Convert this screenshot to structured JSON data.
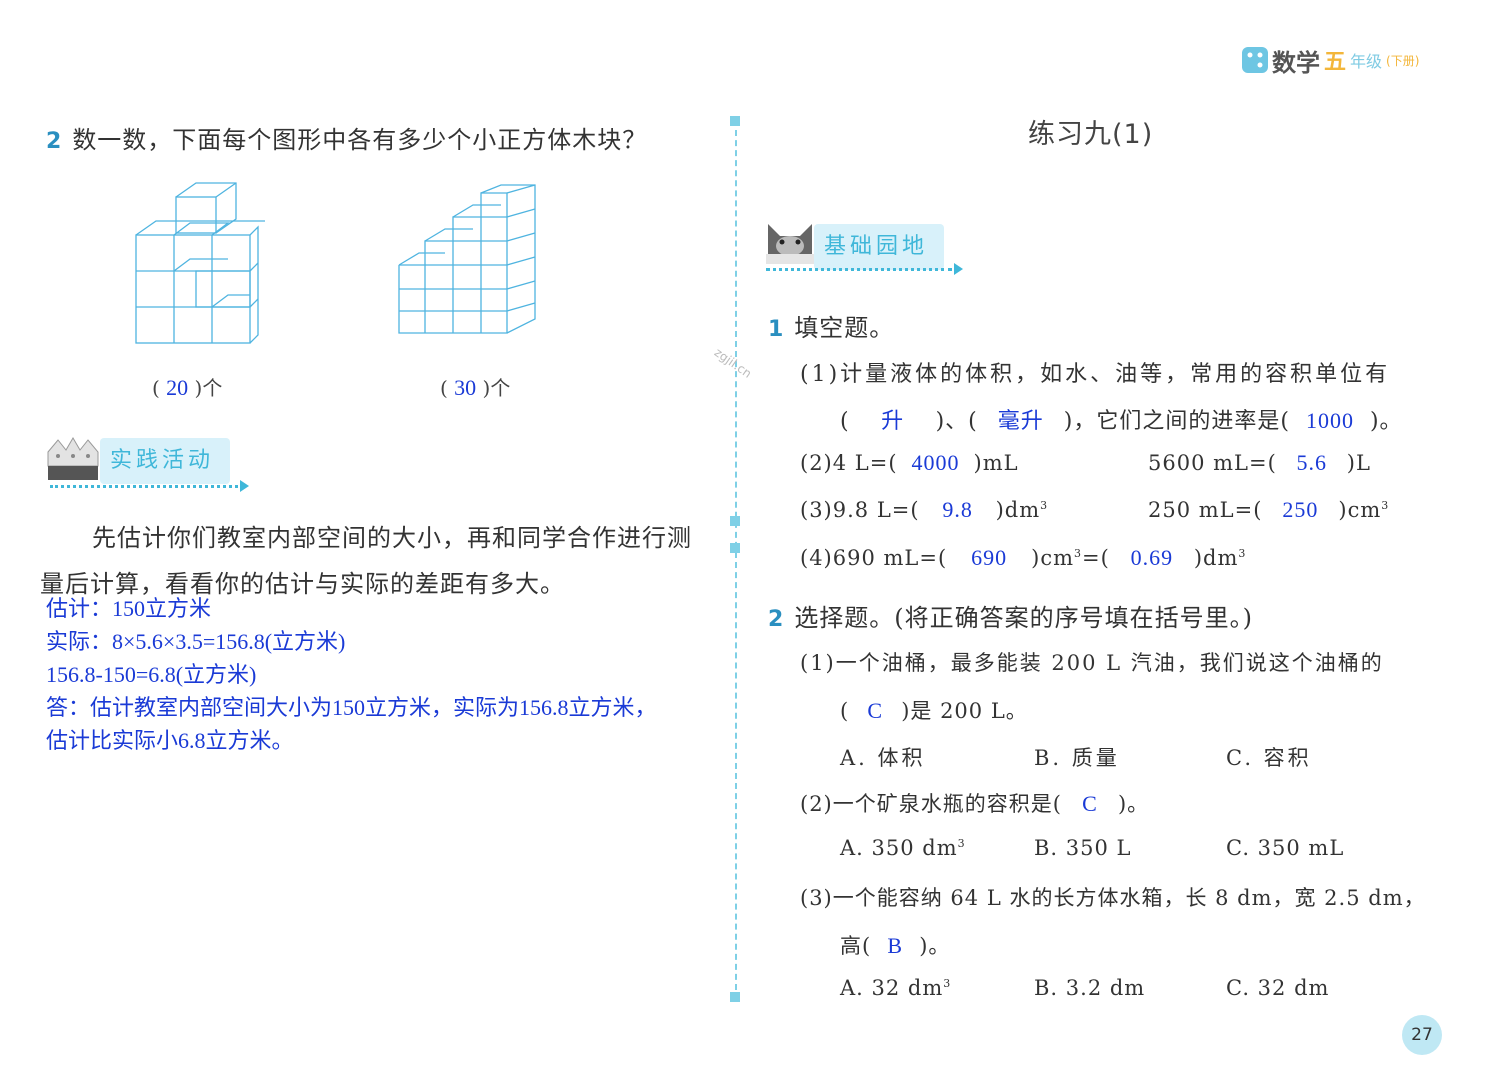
{
  "header": {
    "logo_text": "数学",
    "grade": "五",
    "grade_suffix": "年级",
    "volume": "(下册)"
  },
  "left": {
    "q2": {
      "num": "2",
      "text": "数一数，下面每个图形中各有多少个小正方体木块？",
      "fig1_answer": "20",
      "fig2_answer": "30",
      "unit": "个"
    },
    "practice": {
      "banner": "实践活动",
      "line1": "先估计你们教室内部空间的大小，再和同学合作进行测",
      "line2": "量后计算，看看你的估计与实际的差距有多大。",
      "answer_lines": [
        "估计：150立方米",
        "实际：8×5.6×3.5=156.8(立方米)",
        "156.8-150=6.8(立方米)",
        "答：估计教室内部空间大小为150立方米，实际为156.8立方米，",
        "估计比实际小6.8立方米。"
      ]
    }
  },
  "right": {
    "title": "练习九(1)",
    "banner": "基础园地",
    "watermark": "zgjil.cn",
    "q1": {
      "num": "1",
      "title": "填空题。",
      "p1_line1": "(1)计量液体的体积，如水、油等，常用的容积单位有",
      "p1_a1": "升",
      "p1_mid": ")、(",
      "p1_a2": "毫升",
      "p1_tail": ")，它们之间的进率是(",
      "p1_a3": "1000",
      "p1_end": ")。",
      "p2_left": "(2)4 L=(",
      "p2_a1": "4000",
      "p2_left_unit": ")mL",
      "p2_right": "5600 mL=(",
      "p2_a2": "5.6",
      "p2_right_unit": ")L",
      "p3_left": "(3)9.8 L=(",
      "p3_a1": "9.8",
      "p3_left_unit": ")dm",
      "p3_right": "250 mL=(",
      "p3_a2": "250",
      "p3_right_unit": ")cm",
      "p4_left": "(4)690 mL=(",
      "p4_a1": "690",
      "p4_mid": ")cm",
      "p4_mid2": "=(",
      "p4_a2": "0.69",
      "p4_end": ")dm",
      "sup3": "3"
    },
    "q2": {
      "num": "2",
      "title": "选择题。(将正确答案的序号填在括号里。)",
      "s1_line1": "(1)一个油桶，最多能装 200 L 汽油，我们说这个油桶的",
      "s1_open": "(",
      "s1_ans": "C",
      "s1_close": ")是 200 L。",
      "s1_options": [
        "A. 体积",
        "B. 质量",
        "C. 容积"
      ],
      "s2_line": "(2)一个矿泉水瓶的容积是(",
      "s2_ans": "C",
      "s2_close": ")。",
      "s2_options": [
        "A. 350 dm",
        "B. 350 L",
        "C. 350 mL"
      ],
      "s3_line1": "(3)一个能容纳 64 L 水的长方体水箱，长 8 dm，宽 2.5 dm，",
      "s3_prefix": "高(",
      "s3_ans": "B",
      "s3_close": ")。",
      "s3_options": [
        "A. 32 dm",
        "B. 3.2 dm",
        "C. 32 dm"
      ]
    }
  },
  "page_number": "27",
  "colors": {
    "accent": "#3fb7d9",
    "answer": "#1a3ad6",
    "cube": "#4fb4e0"
  }
}
